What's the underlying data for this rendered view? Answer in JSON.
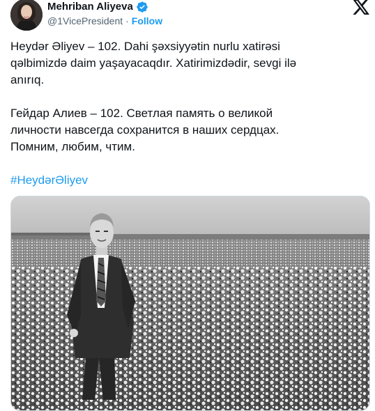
{
  "author": {
    "name": "Mehriban Aliyeva",
    "handle": "@1VicePresident",
    "separator": "·",
    "follow_label": "Follow",
    "verified_color": "#1d9bf0"
  },
  "icons": {
    "avatar": "profile-photo",
    "verified": "verified-badge-icon",
    "platform": "x-logo-icon"
  },
  "tweet": {
    "paragraph_az": "Heydər Əliyev – 102. Dahi şəxsiyyətin nurlu xatirəsi\nqəlbimizdə daim yaşayacaqdır. Xatirimizdədir, sevgi ilə\nanırıq.",
    "paragraph_ru": "Гейдар Алиев – 102. Светлая память о великой\nличности навсегда сохранится в наших сердцах.\nПомним, любим, чтим.",
    "hashtag": "#HeydərƏliyev"
  },
  "colors": {
    "accent": "#1d9bf0",
    "text": "#0f1419",
    "secondary": "#536471"
  }
}
